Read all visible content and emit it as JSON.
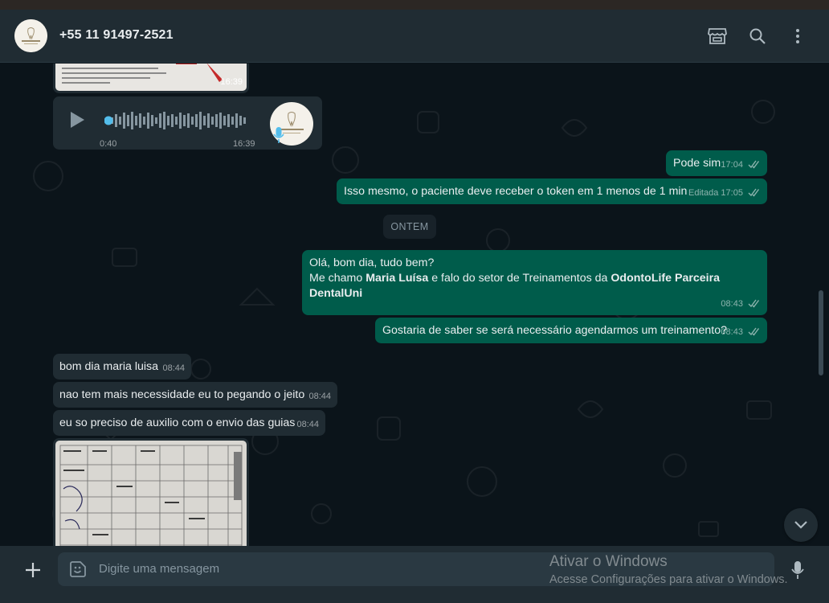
{
  "header": {
    "contact_name": "+55 11 91497-2521",
    "avatar_icon": "dental-clinic-logo",
    "actions": [
      "catalog-icon",
      "search-icon",
      "menu-icon"
    ]
  },
  "messages": {
    "top_image_time": "16:39",
    "audio": {
      "elapsed": "0:40",
      "time": "16:39"
    },
    "m1": {
      "text": "Pode sim",
      "time": "17:04"
    },
    "m2": {
      "text": "Isso mesmo, o paciente deve receber o token em 1 menos de 1 min",
      "edited": "Editada",
      "time": "17:05"
    },
    "day_divider": "ONTEM",
    "m3": {
      "line1": "Olá, bom dia, tudo bem?",
      "line2_a": "Me chamo ",
      "line2_b": "Maria Luísa",
      "line2_c": " e falo do setor de Treinamentos da ",
      "line2_d": "OdontoLife Parceira",
      "line3": "DentalUni",
      "time": "08:43"
    },
    "m4": {
      "text": "Gostaria de saber se será necessário agendarmos um treinamento?",
      "time": "08:43"
    },
    "m5": {
      "text": "bom dia maria luisa",
      "time": "08:44"
    },
    "m6": {
      "text": "nao tem mais necessidade eu to pegando o jeito",
      "time": "08:44"
    },
    "m7": {
      "text": "eu so preciso de auxilio com o envio das guias",
      "time": "08:44"
    }
  },
  "composer": {
    "placeholder": "Digite uma mensagem"
  },
  "watermark": {
    "title": "Ativar o Windows",
    "subtitle": "Acesse Configurações para ativar o Windows."
  },
  "colors": {
    "outgoing": "#005c4b",
    "incoming": "#202c33",
    "background": "#0b141a",
    "accent_blue": "#53bdeb"
  }
}
